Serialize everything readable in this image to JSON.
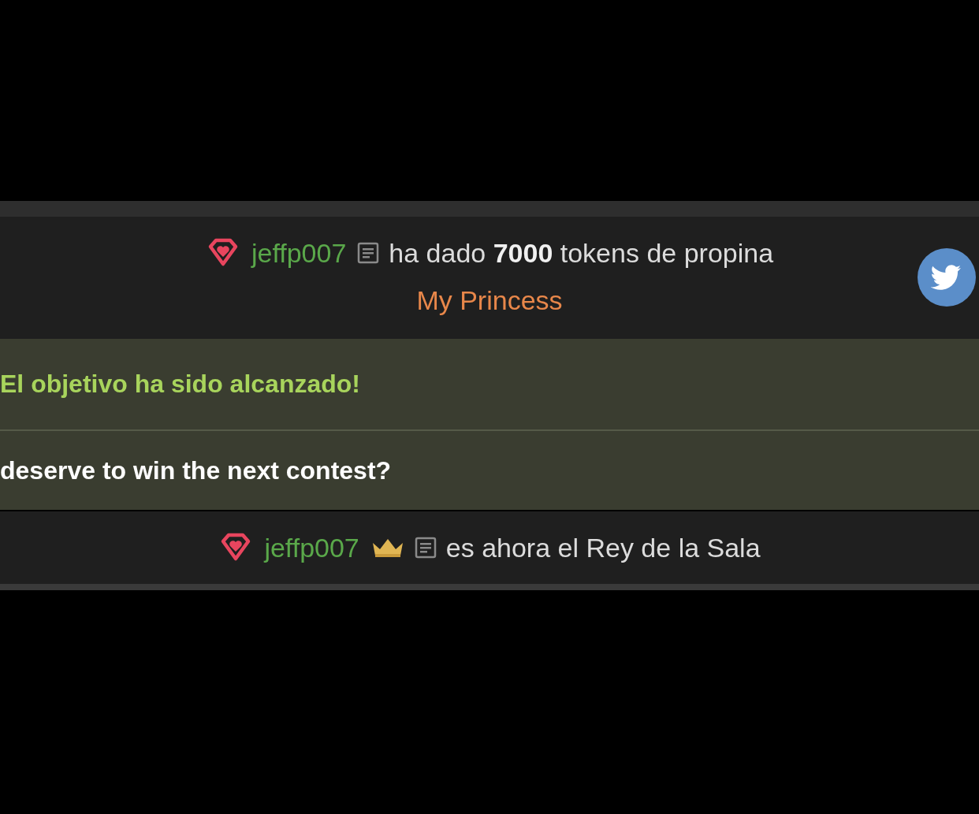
{
  "feed": [
    {
      "kind": "tip",
      "user": "jeffp007",
      "text": "ha dado **7000** tokens de propina",
      "note": "My Princess",
      "crown": false,
      "share_button": true
    },
    {
      "kind": "goal",
      "lines": [
        "El objetivo ha sido alcanzado!",
        "deserve to win the next contest?"
      ]
    },
    {
      "kind": "king",
      "user": "jeffp007",
      "text": "es ahora el Rey de la Sala",
      "crown": true,
      "share_button": false
    }
  ]
}
